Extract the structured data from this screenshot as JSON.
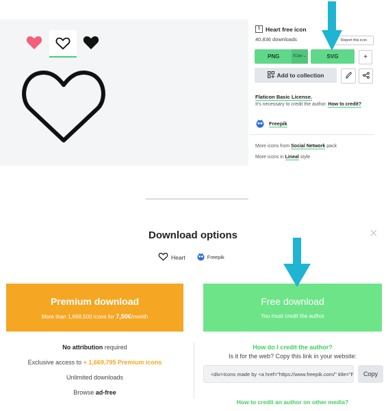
{
  "icon_panel": {
    "title": "Heart free icon",
    "title_badge": "S",
    "downloads": "40,836 downloads",
    "report_label": "Report this icon",
    "png_label": "PNG",
    "png_size": "512px ⌄",
    "svg_label": "SVG",
    "plus_label": "+",
    "add_collection_label": "Add to collection",
    "license_title": "Flaticon Basic License.",
    "license_text": "It's necessary to credit the author.",
    "how_to_credit": "How to credit?",
    "author": "Freepik",
    "more_pack_prefix": "More icons from",
    "more_pack_link": "Social Network",
    "more_pack_suffix": "pack",
    "more_style_prefix": "More icons in",
    "more_style_link": "Lineal",
    "more_style_suffix": "style"
  },
  "modal": {
    "title": "Download options",
    "close": "×",
    "icon_name": "Heart",
    "author": "Freepik",
    "premium": {
      "title": "Premium download",
      "subtitle": "More than 1,669,500 icons for",
      "price": "7,50€",
      "per": "/month",
      "no_attr_bold": "No attribution",
      "no_attr_rest": "required",
      "exclusive_prefix": "Exclusive access to",
      "exclusive_link": "+ 1,669,795 Premium icons",
      "unlimited": "Unlimited downloads",
      "browse_prefix": "Browse",
      "browse_bold": "ad-free"
    },
    "free": {
      "title": "Free download",
      "subtitle": "You must credit the author",
      "how_credit": "How do I credit the author?",
      "web_text": "Is it for the web? Copy this link in your website:",
      "code": "<div>Icons made by <a href=\"https://www.freepik.com/\" title=\"Freepik\">Freepik</a>",
      "copy_label": "Copy",
      "other_media": "How to credit an author on other media?"
    }
  },
  "colors": {
    "green": "#5fd88a",
    "free_green": "#6de488",
    "premium_orange": "#f5a623",
    "arrow_cyan": "#1fb4d2",
    "heart_pink": "#f2607a"
  }
}
